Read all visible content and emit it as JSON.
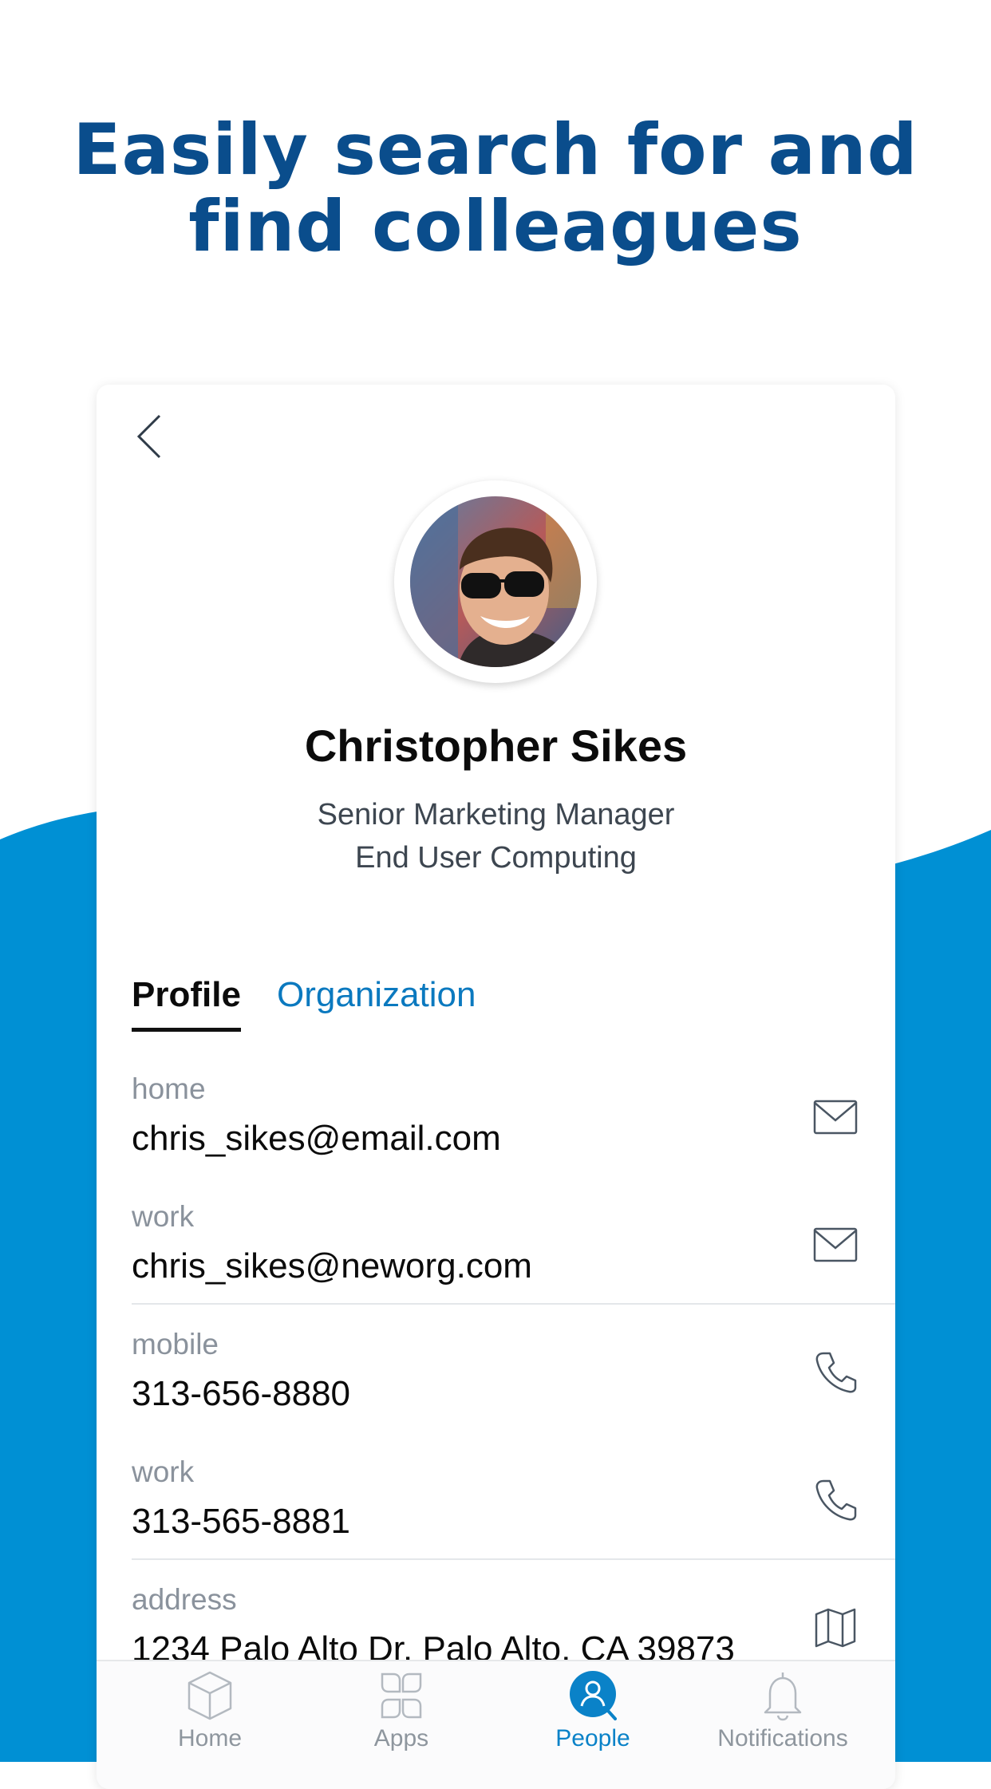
{
  "headline": {
    "line1": "Easily search for and",
    "line2": "find colleagues"
  },
  "colors": {
    "headline": "#0a4d8c",
    "wave": "#0090d4",
    "accent": "#0a82c8",
    "tab_inactive": "#0b79bf"
  },
  "profile": {
    "name": "Christopher Sikes",
    "title": "Senior Marketing Manager",
    "department": "End User Computing"
  },
  "tabs": [
    {
      "label": "Profile",
      "active": true
    },
    {
      "label": "Organization",
      "active": false
    }
  ],
  "fields": [
    {
      "label": "home",
      "value": "chris_sikes@email.com",
      "icon": "mail-icon"
    },
    {
      "label": "work",
      "value": "chris_sikes@neworg.com",
      "icon": "mail-icon"
    },
    {
      "label": "mobile",
      "value": "313-656-8880",
      "icon": "phone-icon"
    },
    {
      "label": "work",
      "value": "313-565-8881",
      "icon": "phone-icon"
    },
    {
      "label": "address",
      "value": "1234 Palo Alto Dr. Palo Alto, CA 39873",
      "icon": "map-icon"
    }
  ],
  "bottom_nav": [
    {
      "label": "Home",
      "icon": "cube-icon",
      "active": false
    },
    {
      "label": "Apps",
      "icon": "apps-grid-icon",
      "active": false
    },
    {
      "label": "People",
      "icon": "person-search-icon",
      "active": true
    },
    {
      "label": "Notifications",
      "icon": "bell-icon",
      "active": false
    }
  ]
}
